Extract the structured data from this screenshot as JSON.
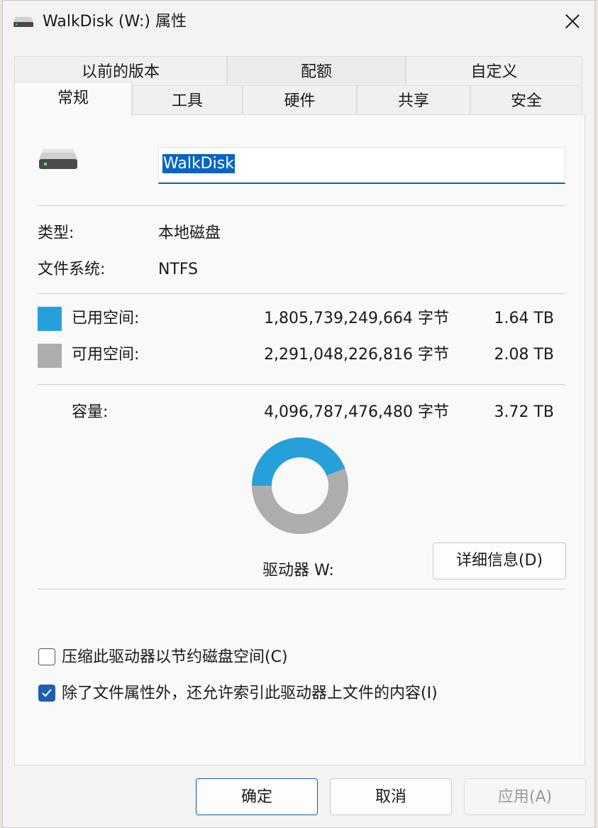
{
  "window": {
    "title": "WalkDisk (W:) 属性"
  },
  "tabs_row1": [
    {
      "label": "以前的版本"
    },
    {
      "label": "配额"
    },
    {
      "label": "自定义"
    }
  ],
  "tabs_row2": [
    {
      "label": "常规",
      "active": true
    },
    {
      "label": "工具"
    },
    {
      "label": "硬件"
    },
    {
      "label": "共享"
    },
    {
      "label": "安全"
    }
  ],
  "general": {
    "drive_name": "WalkDisk",
    "type_label": "类型:",
    "type_value": "本地磁盘",
    "fs_label": "文件系统:",
    "fs_value": "NTFS",
    "used": {
      "label": "已用空间:",
      "bytes": "1,805,739,249,664 字节",
      "size": "1.64 TB",
      "color": "#26a0da"
    },
    "free": {
      "label": "可用空间:",
      "bytes": "2,291,048,226,816 字节",
      "size": "2.08 TB",
      "color": "#adadad"
    },
    "capacity": {
      "label": "容量:",
      "bytes": "4,096,787,476,480 字节",
      "size": "3.72 TB"
    },
    "used_fraction": 0.4408,
    "drive_label": "驱动器 W:",
    "details_button": "详细信息(D)",
    "compress": {
      "label": "压缩此驱动器以节约磁盘空间(C)",
      "checked": false
    },
    "index": {
      "label": "除了文件属性外，还允许索引此驱动器上文件的内容(I)",
      "checked": true
    }
  },
  "footer": {
    "ok": "确定",
    "cancel": "取消",
    "apply": "应用(A)"
  }
}
